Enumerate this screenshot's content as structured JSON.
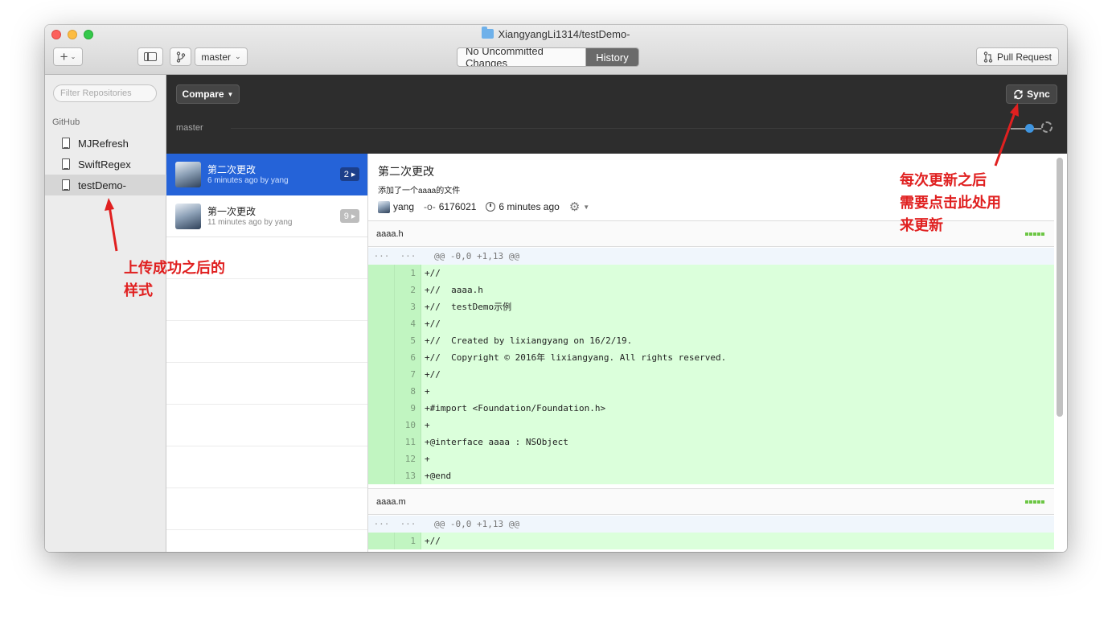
{
  "window": {
    "title": "XiangyangLi1314/testDemo-"
  },
  "toolbar": {
    "add_label": "+",
    "branch_label": "master",
    "tab_uncommitted": "No Uncommitted Changes",
    "tab_history": "History",
    "pull_request_label": "Pull Request"
  },
  "sidebar": {
    "filter_placeholder": "Filter Repositories",
    "section": "GitHub",
    "repos": [
      {
        "label": "MJRefresh",
        "selected": false
      },
      {
        "label": "SwiftRegex",
        "selected": false
      },
      {
        "label": "testDemo-",
        "selected": true
      }
    ]
  },
  "history_bar": {
    "compare_label": "Compare",
    "sync_label": "Sync",
    "branch": "master"
  },
  "commits": [
    {
      "title": "第二次更改",
      "subtitle": "6 minutes ago by yang",
      "count": "2",
      "selected": true
    },
    {
      "title": "第一次更改",
      "subtitle": "11 minutes ago by yang",
      "count": "9",
      "selected": false
    }
  ],
  "detail": {
    "title": "第二次更改",
    "description": "添加了一个aaaa的文件",
    "author": "yang",
    "sha": "6176021",
    "time": "6 minutes ago",
    "files": [
      {
        "name": "aaaa.h",
        "hunk": "@@ -0,0 +1,13 @@",
        "lines": [
          {
            "num": "1",
            "text": "//"
          },
          {
            "num": "2",
            "text": "//  aaaa.h"
          },
          {
            "num": "3",
            "text": "//  testDemo示例"
          },
          {
            "num": "4",
            "text": "//"
          },
          {
            "num": "5",
            "text": "//  Created by lixiangyang on 16/2/19."
          },
          {
            "num": "6",
            "text": "//  Copyright © 2016年 lixiangyang. All rights reserved."
          },
          {
            "num": "7",
            "text": "//"
          },
          {
            "num": "8",
            "text": ""
          },
          {
            "num": "9",
            "text": "#import <Foundation/Foundation.h>"
          },
          {
            "num": "10",
            "text": ""
          },
          {
            "num": "11",
            "text": "@interface aaaa : NSObject"
          },
          {
            "num": "12",
            "text": ""
          },
          {
            "num": "13",
            "text": "@end"
          }
        ]
      },
      {
        "name": "aaaa.m",
        "hunk": "@@ -0,0 +1,13 @@",
        "lines": [
          {
            "num": "1",
            "text": "//"
          }
        ]
      }
    ]
  },
  "annotations": {
    "sidebar_note_line1": "上传成功之后的",
    "sidebar_note_line2": "样式",
    "sync_note_line1": "每次更新之后",
    "sync_note_line2": "需要点击此处用",
    "sync_note_line3": "来更新"
  },
  "colors": {
    "selection_blue": "#2563d8",
    "added_line_green": "#dbffdb",
    "annotation_red": "#e02020"
  }
}
